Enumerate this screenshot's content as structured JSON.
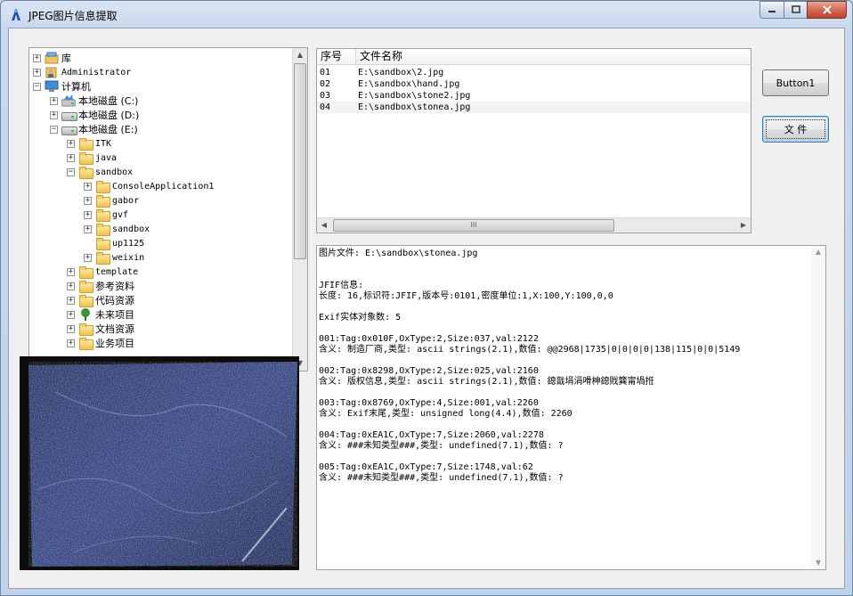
{
  "window": {
    "title": "JPEG图片信息提取"
  },
  "tree": {
    "items": [
      {
        "label": "库",
        "exp": "+",
        "icon": "library-icon"
      },
      {
        "label": "Administrator",
        "exp": "+",
        "icon": "user-icon"
      },
      {
        "label": "计算机",
        "exp": "−",
        "icon": "computer-icon"
      },
      {
        "label": "本地磁盘 (C:)",
        "exp": "+",
        "icon": "drive-c-icon"
      },
      {
        "label": "本地磁盘 (D:)",
        "exp": "+",
        "icon": "drive-icon"
      },
      {
        "label": "本地磁盘 (E:)",
        "exp": "−",
        "icon": "drive-icon"
      },
      {
        "label": "ITK",
        "exp": "+",
        "icon": "folder-icon"
      },
      {
        "label": "java",
        "exp": "+",
        "icon": "folder-icon"
      },
      {
        "label": "sandbox",
        "exp": "−",
        "icon": "folder-icon"
      },
      {
        "label": "ConsoleApplication1",
        "exp": "+",
        "icon": "folder-icon"
      },
      {
        "label": "gabor",
        "exp": "+",
        "icon": "folder-icon"
      },
      {
        "label": "gvf",
        "exp": "+",
        "icon": "folder-icon"
      },
      {
        "label": "sandbox",
        "exp": "+",
        "icon": "folder-icon"
      },
      {
        "label": "up1125",
        "exp": "",
        "icon": "folder-icon"
      },
      {
        "label": "weixin",
        "exp": "+",
        "icon": "folder-icon"
      },
      {
        "label": "template",
        "exp": "+",
        "icon": "folder-icon"
      },
      {
        "label": "参考资料",
        "exp": "+",
        "icon": "folder-icon"
      },
      {
        "label": "代码资源",
        "exp": "+",
        "icon": "folder-icon"
      },
      {
        "label": "未来项目",
        "exp": "+",
        "icon": "tree-plant-icon"
      },
      {
        "label": "文档资源",
        "exp": "+",
        "icon": "folder-icon"
      },
      {
        "label": "业务项目",
        "exp": "+",
        "icon": "folder-icon"
      }
    ]
  },
  "list": {
    "col_index": "序号",
    "col_name": "文件名称",
    "rows": [
      {
        "index": "01",
        "name": "E:\\sandbox\\2.jpg"
      },
      {
        "index": "02",
        "name": "E:\\sandbox\\hand.jpg"
      },
      {
        "index": "03",
        "name": "E:\\sandbox\\stone2.jpg"
      },
      {
        "index": "04",
        "name": "E:\\sandbox\\stonea.jpg"
      }
    ],
    "hscroll_grip": "III"
  },
  "buttons": {
    "button1": "Button1",
    "file": "文 件"
  },
  "info": {
    "lines": [
      "图片文件: E:\\sandbox\\stonea.jpg",
      "",
      "",
      "JFIF信息:",
      "长度: 16,标识符:JFIF,版本号:0101,密度单位:1,X:100,Y:100,0,0",
      "",
      "Exif实体对象数: 5",
      "",
      "001:Tag:0x010F,OxType:2,Size:037,val:2122",
      "含义: 制造厂商,类型: ascii strings(2.1),数值: @@2968|1735|0|0|0|0|138|115|0|0|5149",
      "",
      "002:Tag:0x8298,OxType:2,Size:025,val:2160",
      "含义: 版权信息,类型: ascii strings(2.1),数值: 鎴戠埍涓嗗柛鎴戝簨甯堝拰",
      "",
      "003:Tag:0x8769,OxType:4,Size:001,val:2260",
      "含义: Exif末尾,类型: unsigned long(4.4),数值: 2260",
      "",
      "004:Tag:0xEA1C,OxType:7,Size:2060,val:2278",
      "含义: ###未知类型###,类型: undefined(7.1),数值: ?",
      "",
      "005:Tag:0xEA1C,OxType:7,Size:1748,val:62",
      "含义: ###未知类型###,类型: undefined(7.1),数值: ?"
    ]
  }
}
